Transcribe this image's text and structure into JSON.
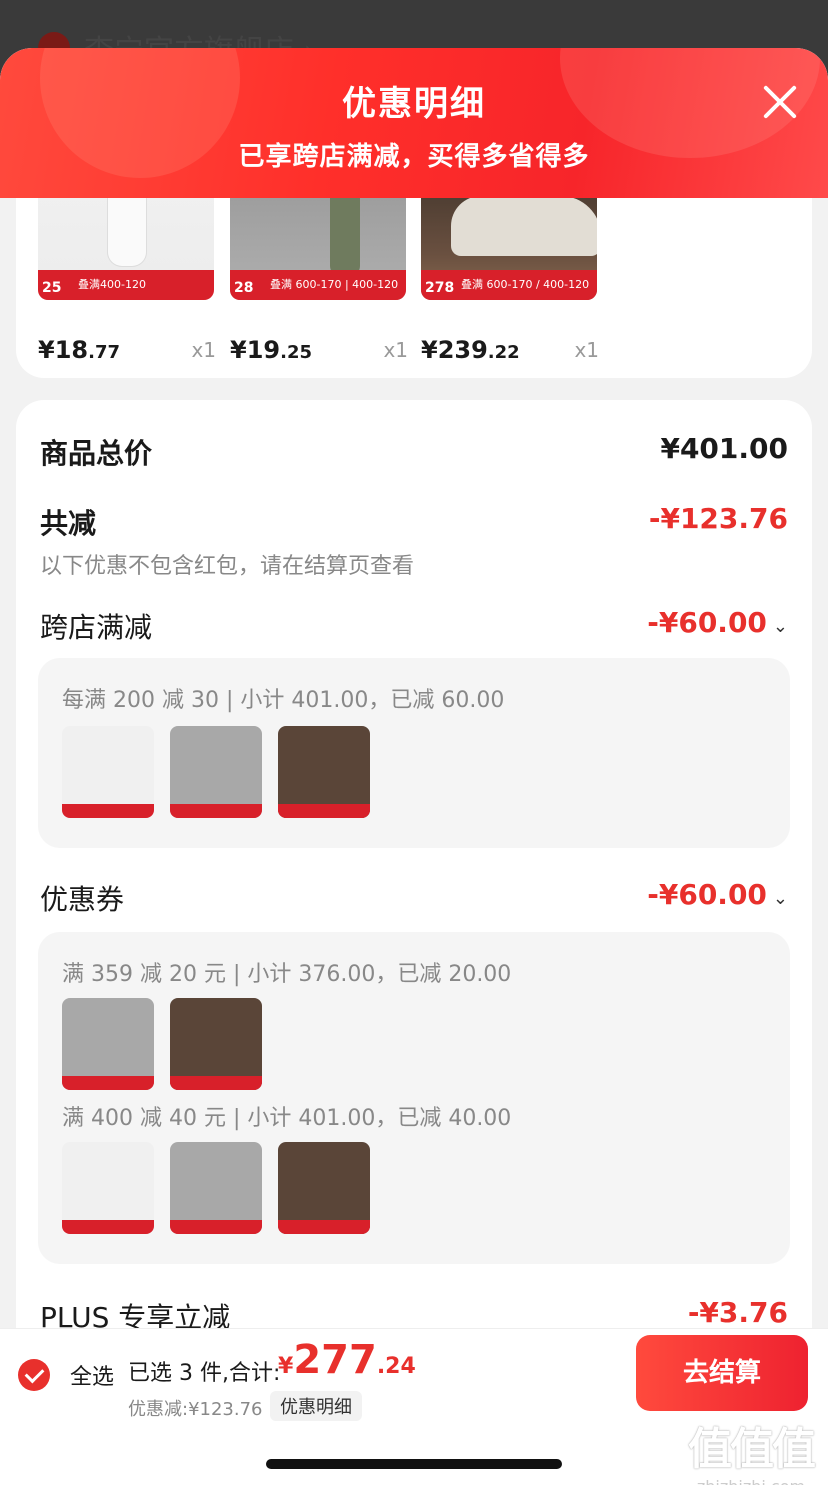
{
  "background": {
    "store_name": "李宁官方旗舰店 ›"
  },
  "sheet": {
    "title": "优惠明细",
    "subtitle": "已享跨店满减，买得多省得多"
  },
  "products": [
    {
      "price_int": "¥18",
      "price_dec": ".77",
      "qty": "x1",
      "band_num": "25",
      "band_text": "叠满400-120"
    },
    {
      "price_int": "¥19",
      "price_dec": ".25",
      "qty": "x1",
      "band_num": "28",
      "band_text": "叠满 600-170 | 400-120"
    },
    {
      "price_int": "¥239",
      "price_dec": ".22",
      "qty": "x1",
      "band_num": "278",
      "band_text": "叠满 600-170 / 400-120"
    }
  ],
  "summary": {
    "total_label": "商品总价",
    "total_value": "¥401.00",
    "reduce_label": "共减",
    "reduce_value": "-¥123.76",
    "note": "以下优惠不包含红包，请在结算页查看",
    "cross_store": {
      "label": "跨店满减",
      "value": "-¥60.00",
      "rule": "每满 200 减 30 | 小计 401.00，已减 60.00"
    },
    "coupon": {
      "label": "优惠券",
      "value": "-¥60.00",
      "rule1": "满 359 减 20 元 | 小计 376.00，已减 20.00",
      "rule2": "满 400 减 40 元 | 小计 401.00，已减 40.00"
    },
    "plus": {
      "label": "PLUS 专享立减",
      "value": "-¥3.76"
    }
  },
  "bottom_bar": {
    "select_all": "全选",
    "selected_count": "已选 3 件,合计:",
    "total_symbol": "¥",
    "total_int": "277",
    "total_dec": ".24",
    "discount_sub": "优惠减:¥123.76",
    "detail_btn": "优惠明细",
    "checkout": "去结算"
  },
  "watermark": {
    "logo": "值值值",
    "text": "zhizhizhi.com"
  },
  "colors": {
    "accent": "#e8302c",
    "header": "#ff2f2a"
  }
}
